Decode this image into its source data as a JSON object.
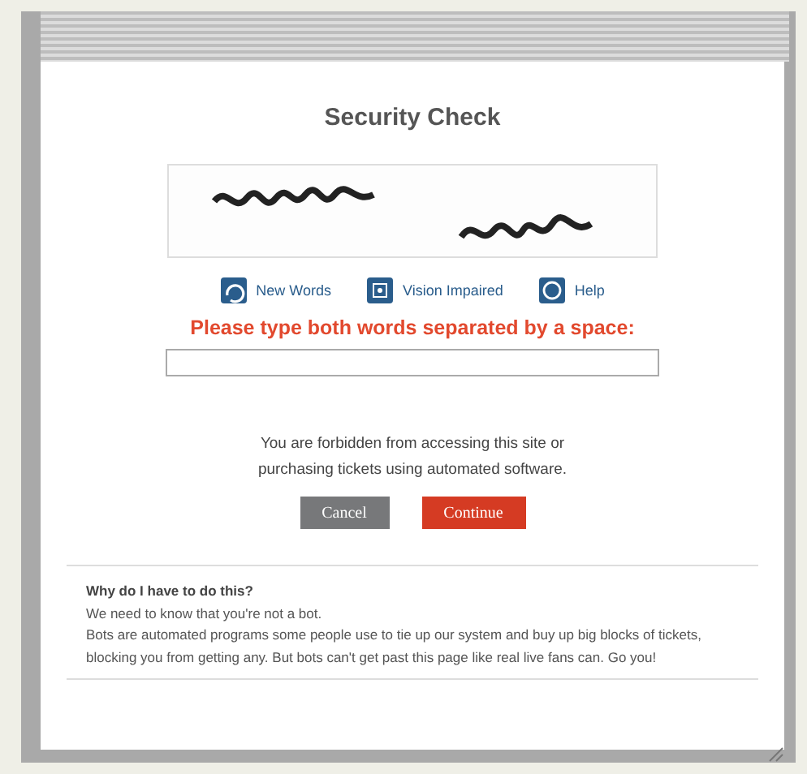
{
  "dialog": {
    "title": "Security Check",
    "links": [
      {
        "label": "New Words"
      },
      {
        "label": "Vision Impaired"
      },
      {
        "label": "Help"
      }
    ],
    "prompt": "Please type both words separated by a space:",
    "notice": "You are forbidden from accessing this site or purchasing tickets using automated software.",
    "buttons": [
      {
        "label": "Cancel",
        "kind": "secondary"
      },
      {
        "label": "Continue",
        "kind": "primary"
      }
    ],
    "faq": {
      "heading": "Why do I have to do this?",
      "lines": [
        "We need to know that you're not a bot.",
        "Bots are automated programs some people use to tie up our system and buy up big blocks of tickets, blocking you from getting any. But bots can't get past this page like real live fans can. Go you!"
      ]
    }
  }
}
